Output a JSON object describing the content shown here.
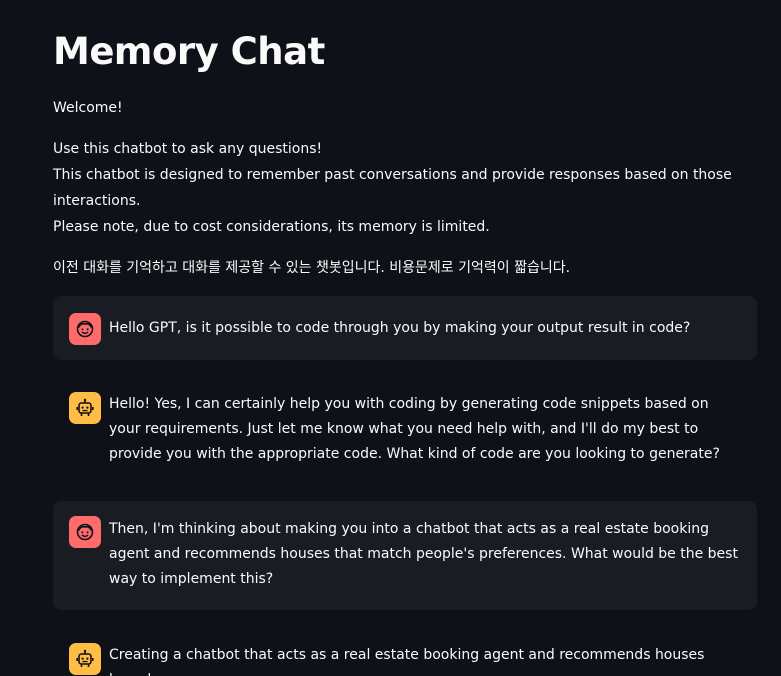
{
  "title": "Memory Chat",
  "welcome": "Welcome!",
  "intro_lines": [
    "Use this chatbot to ask any questions!",
    "This chatbot is designed to remember past conversations and provide responses based on those interactions.",
    "Please note, due to cost considerations, its memory is limited."
  ],
  "korean_note": "이전 대화를 기억하고 대화를 제공할 수 있는 챗봇입니다. 비용문제로 기억력이 짧습니다.",
  "colors": {
    "background": "#0e1117",
    "user_bubble": "#1a1c24",
    "user_avatar": "#ff6b6b",
    "bot_avatar": "#ffbd45",
    "text": "#fafafa"
  },
  "messages": [
    {
      "role": "user",
      "icon": "user-face-icon",
      "text": "Hello GPT, is it possible to code through you by making your output result in code?"
    },
    {
      "role": "assistant",
      "icon": "robot-icon",
      "text": "Hello! Yes, I can certainly help you with coding by generating code snippets based on your requirements. Just let me know what you need help with, and I'll do my best to provide you with the appropriate code. What kind of code are you looking to generate?"
    },
    {
      "role": "user",
      "icon": "user-face-icon",
      "text": "Then, I'm thinking about making you into a chatbot that acts as a real estate booking agent and recommends houses that match people's preferences. What would be the best way to implement this?"
    },
    {
      "role": "assistant",
      "icon": "robot-icon",
      "text": "Creating a chatbot that acts as a real estate booking agent and recommends houses based on"
    }
  ]
}
